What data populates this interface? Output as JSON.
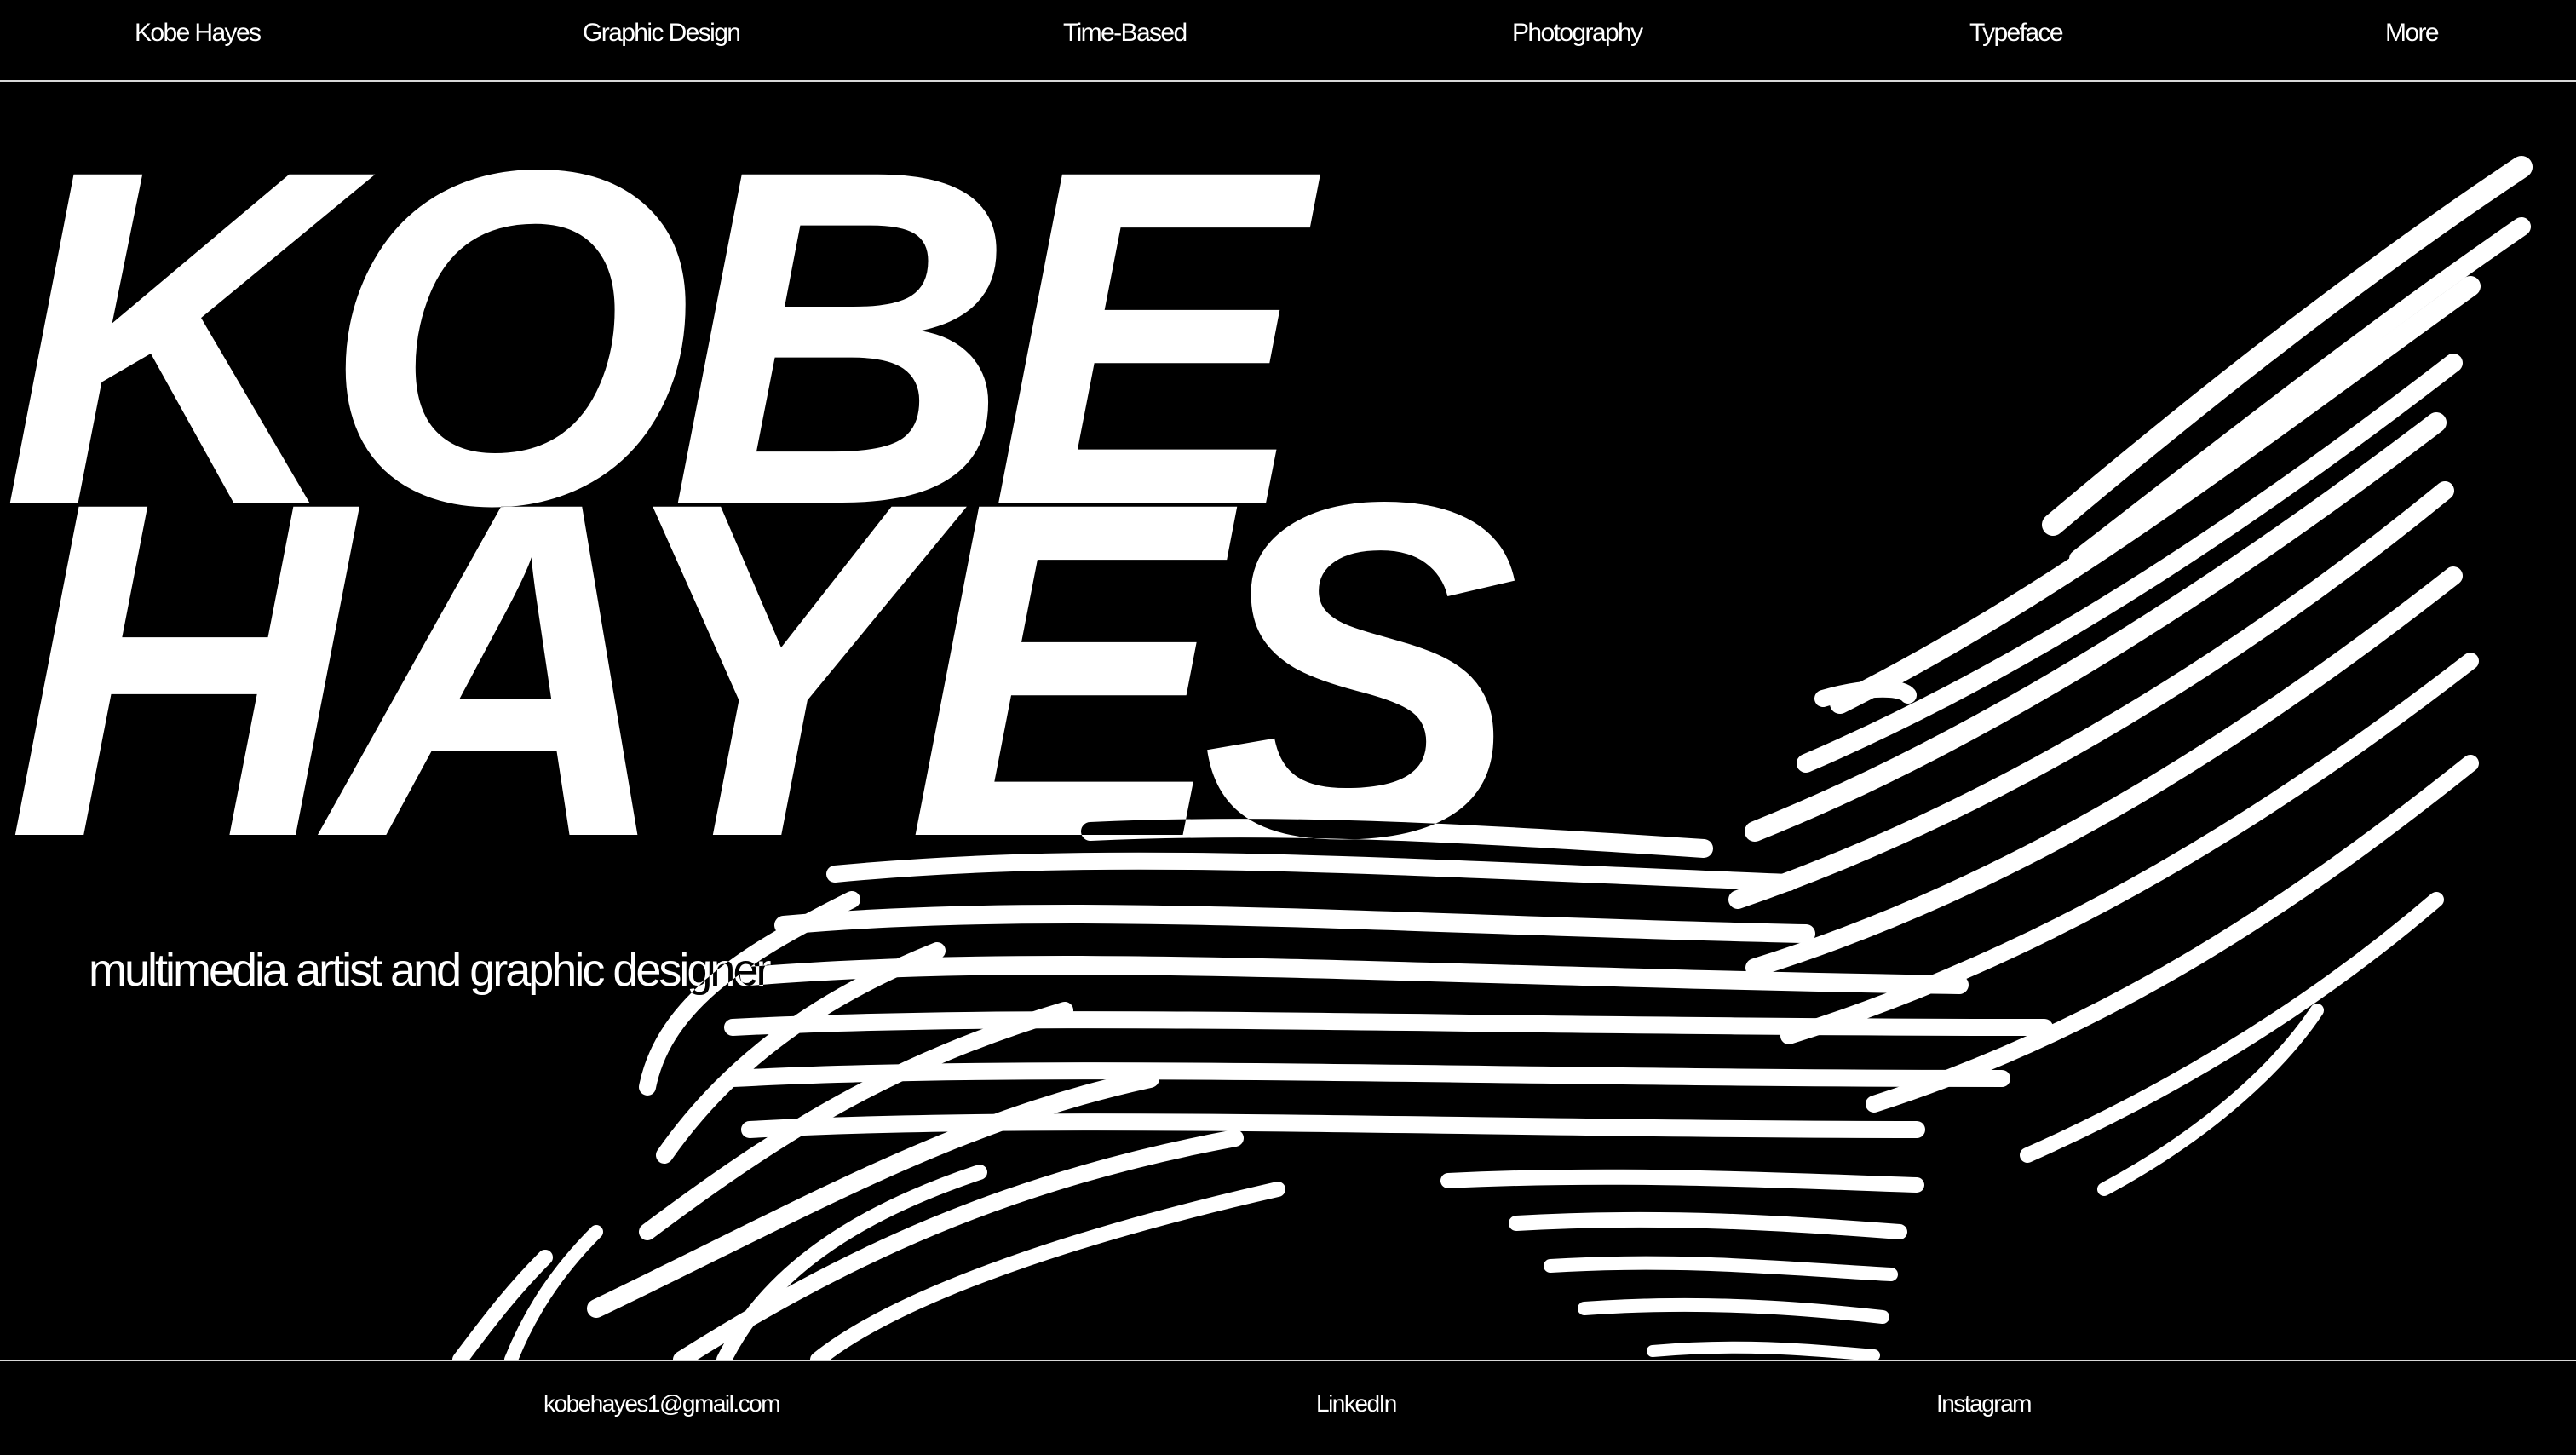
{
  "nav": {
    "items": [
      {
        "label": "Kobe Hayes"
      },
      {
        "label": "Graphic Design"
      },
      {
        "label": "Time-Based"
      },
      {
        "label": "Photography"
      },
      {
        "label": "Typeface"
      },
      {
        "label": "More"
      }
    ]
  },
  "hero": {
    "title_line_1": "KOBE",
    "title_line_2": "HAYES",
    "tagline": "multimedia artist and graphic designer",
    "artwork_icon": "warped-stripes-artwork"
  },
  "footer": {
    "links": [
      {
        "label": "kobehayes1@gmail.com"
      },
      {
        "label": "LinkedIn"
      },
      {
        "label": "Instagram"
      }
    ]
  },
  "colors": {
    "background": "#000000",
    "foreground": "#ffffff",
    "rule": "#d8d8d8"
  }
}
